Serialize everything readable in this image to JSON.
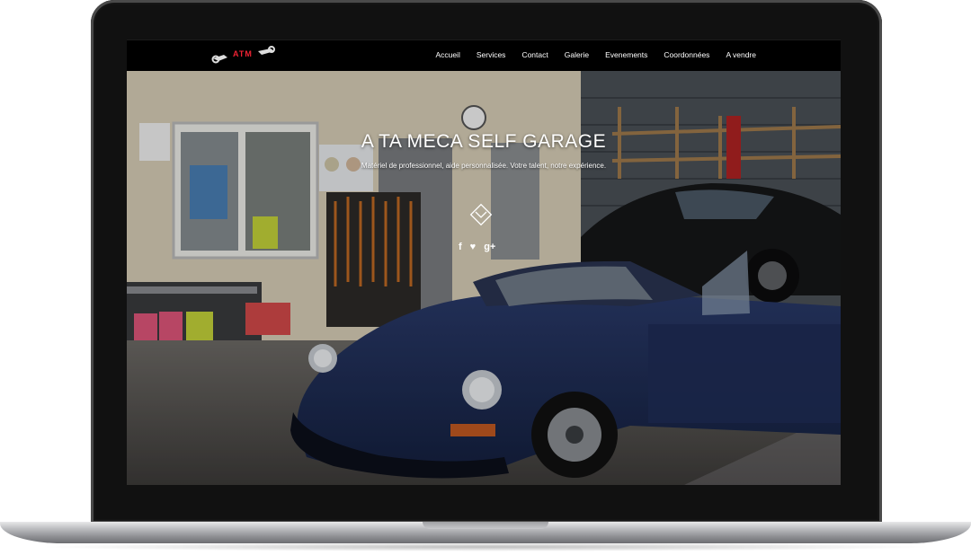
{
  "navbar": {
    "logo_text": "ATM",
    "items": [
      {
        "label": "Accueil"
      },
      {
        "label": "Services"
      },
      {
        "label": "Contact"
      },
      {
        "label": "Galerie"
      },
      {
        "label": "Evenements"
      },
      {
        "label": "Coordonnées"
      },
      {
        "label": "A vendre"
      }
    ]
  },
  "hero": {
    "title": "A TA MECA SELF GARAGE",
    "subtitle": "Matériel de professionnel, aide personnalisée. Votre talent, notre expérience.",
    "scroll_icon": "chevron-down-circle-icon",
    "social": [
      {
        "label": "f",
        "icon": "facebook-icon"
      },
      {
        "label": "♥",
        "icon": "foursquare-icon"
      },
      {
        "label": "g+",
        "icon": "google-plus-icon"
      }
    ]
  },
  "colors": {
    "navbar_bg": "#000000",
    "car": "#1d2b55",
    "wall": "#d8cfb8",
    "accent_red": "#e0312c"
  }
}
